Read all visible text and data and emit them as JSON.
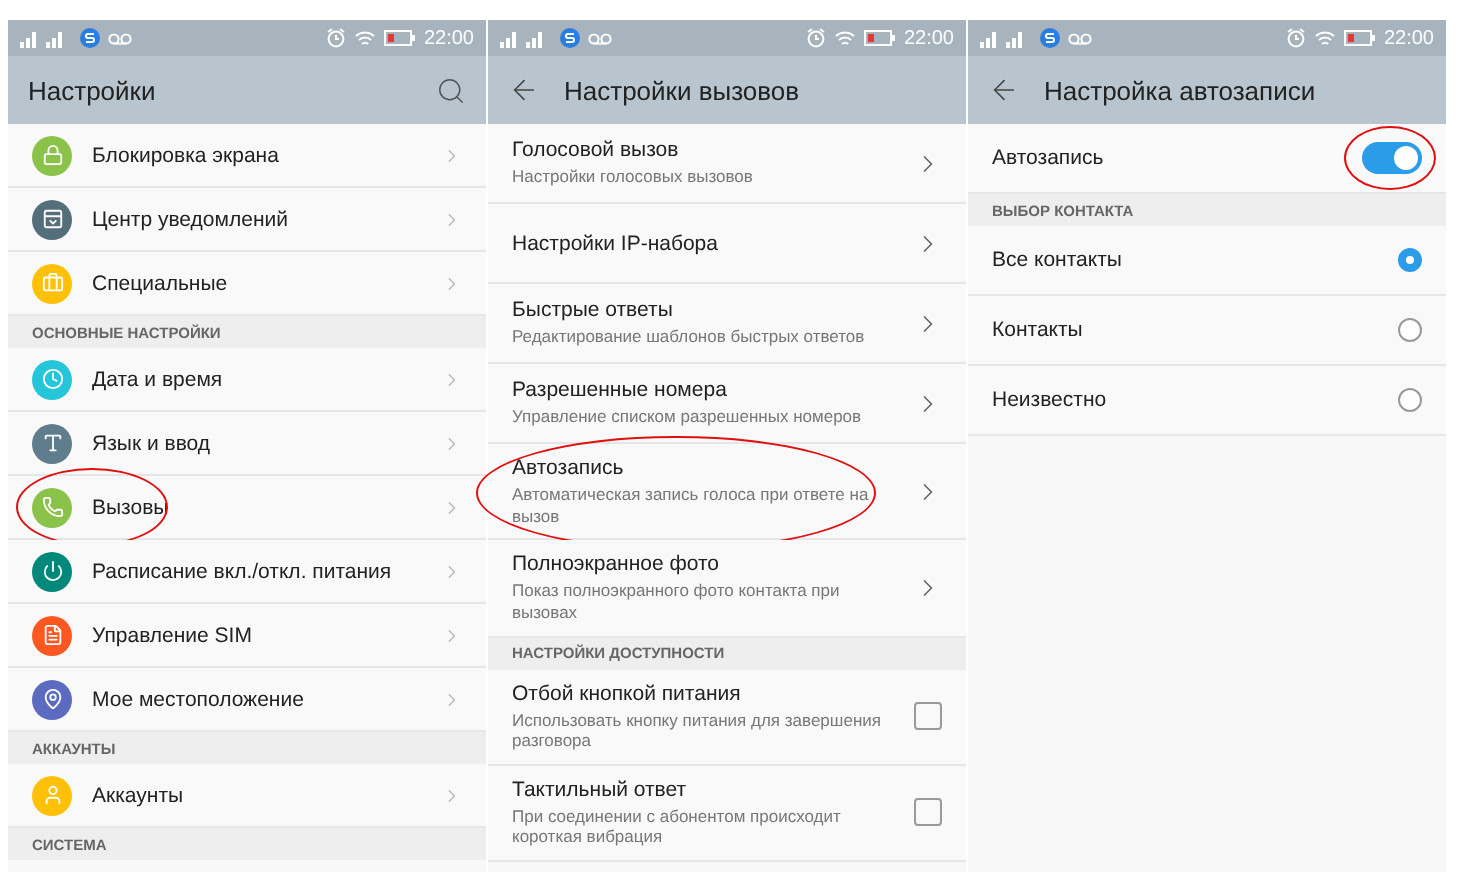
{
  "panels": [
    {
      "status": {
        "time": "22:00"
      },
      "header": {
        "title": "Настройки",
        "back": false,
        "search": true
      },
      "rows": [
        {
          "kind": "nav",
          "title": "Блокировка экрана",
          "color": "#8bc34a",
          "circled": false
        },
        {
          "kind": "nav",
          "title": "Центр уведомлений",
          "color": "#546e7a",
          "circled": false
        },
        {
          "kind": "nav",
          "title": "Специальные",
          "color": "#ffc107",
          "circled": false
        },
        {
          "kind": "section",
          "title": "ОСНОВНЫЕ НАСТРОЙКИ"
        },
        {
          "kind": "nav",
          "title": "Дата и время",
          "color": "#26c6da",
          "circled": false
        },
        {
          "kind": "nav",
          "title": "Язык и ввод",
          "color": "#5f7d8c",
          "circled": false
        },
        {
          "kind": "nav",
          "title": "Вызовы",
          "color": "#8bc34a",
          "circled": true
        },
        {
          "kind": "nav",
          "title": "Расписание вкл./откл. питания",
          "color": "#00897b",
          "circled": false
        },
        {
          "kind": "nav",
          "title": "Управление SIM",
          "color": "#ff5722",
          "circled": false
        },
        {
          "kind": "nav",
          "title": "Мое местоположение",
          "color": "#5c6bc0",
          "circled": false
        },
        {
          "kind": "section",
          "title": "АККАУНТЫ"
        },
        {
          "kind": "nav",
          "title": "Аккаунты",
          "color": "#ffc107",
          "circled": false
        },
        {
          "kind": "section",
          "title": "СИСТЕМА"
        }
      ]
    },
    {
      "status": {
        "time": "22:00"
      },
      "header": {
        "title": "Настройки вызовов",
        "back": true,
        "search": false
      },
      "rows": [
        {
          "kind": "detail",
          "title": "Голосовой вызов",
          "subtitle": "Настройки голосовых вызовов",
          "circled": false
        },
        {
          "kind": "detail",
          "title": "Настройки IP-набора",
          "circled": false
        },
        {
          "kind": "detail",
          "title": "Быстрые ответы",
          "subtitle": "Редактирование шаблонов быстрых ответов",
          "circled": false
        },
        {
          "kind": "detail",
          "title": "Разрешенные номера",
          "subtitle": "Управление списком разрешенных номеров",
          "circled": false
        },
        {
          "kind": "detail",
          "title": "Автозапись",
          "subtitle": "Автоматическая запись голоса при ответе на вызов",
          "circled": true
        },
        {
          "kind": "detail",
          "title": "Полноэкранное фото",
          "subtitle": "Показ полноэкранного фото контакта при вызовах",
          "circled": false
        },
        {
          "kind": "section",
          "title": "НАСТРОЙКИ ДОСТУПНОСТИ"
        },
        {
          "kind": "check",
          "title": "Отбой кнопкой питания",
          "subtitle": "Использовать кнопку питания для завершения разговора",
          "checked": false
        },
        {
          "kind": "check",
          "title": "Тактильный ответ",
          "subtitle": "При соединении с абонентом происходит короткая вибрация",
          "checked": false
        }
      ]
    },
    {
      "status": {
        "time": "22:00"
      },
      "header": {
        "title": "Настройка автозаписи",
        "back": true,
        "search": false
      },
      "rows": [
        {
          "kind": "toggle",
          "title": "Автозапись",
          "on": true,
          "circled": true
        },
        {
          "kind": "section",
          "title": "ВЫБОР КОНТАКТА"
        },
        {
          "kind": "radio",
          "title": "Все контакты",
          "selected": true
        },
        {
          "kind": "radio",
          "title": "Контакты",
          "selected": false
        },
        {
          "kind": "radio",
          "title": "Неизвестно",
          "selected": false
        }
      ]
    }
  ]
}
